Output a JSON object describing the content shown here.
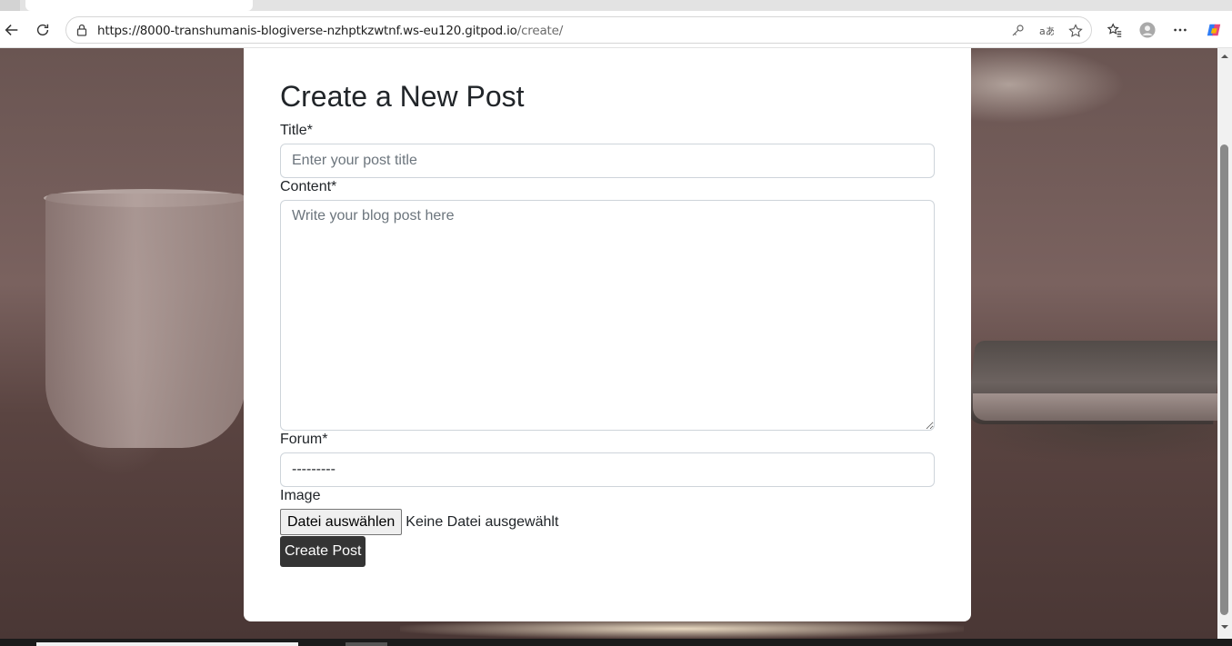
{
  "browser": {
    "url_host": "https://8000-transhumanis-blogiverse-nzhptkzwtnf.ws-eu120.gitpod.io",
    "url_path": "/create/",
    "icons": [
      "back-icon",
      "reload-icon",
      "lock-icon",
      "key-icon",
      "read-aloud-icon",
      "favorite-star-icon",
      "favorites-icon",
      "profile-icon",
      "more-icon",
      "copilot-icon"
    ]
  },
  "form": {
    "heading": "Create a New Post",
    "title_label": "Title*",
    "title_placeholder": "Enter your post title",
    "content_label": "Content*",
    "content_placeholder": "Write your blog post here",
    "forum_label": "Forum*",
    "forum_value": "---------",
    "image_label": "Image",
    "file_button_label": "Datei auswählen",
    "file_status": "Keine Datei ausgewählt",
    "submit_label": "Create Post"
  },
  "colors": {
    "submit_bg": "#343434",
    "page_bg": "#6a5552"
  }
}
